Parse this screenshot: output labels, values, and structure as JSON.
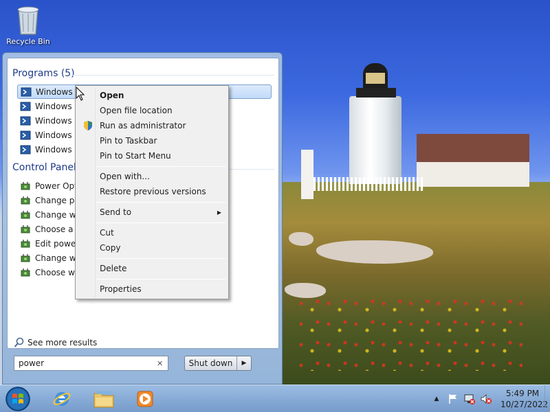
{
  "desktop": {
    "recycle_bin_label": "Recycle Bin"
  },
  "start_menu": {
    "programs_header": "Programs (5)",
    "programs": [
      {
        "label": "Windows PowerShell"
      },
      {
        "label": "Windows PowerShell"
      },
      {
        "label": "Windows PowerShell"
      },
      {
        "label": "Windows PowerShell"
      },
      {
        "label": "Windows PowerShell"
      }
    ],
    "programs_visible": [
      "Windows P",
      "Windows P",
      "Windows P",
      "Windows P",
      "Windows P"
    ],
    "control_panel_header": "Control Panel",
    "control_panel_items": [
      "Power Opti",
      "Change pow",
      "Change wh",
      "Choose a p",
      "Edit power",
      "Change wh",
      "Choose wh"
    ],
    "see_more_label": "See more results",
    "search_value": "power",
    "clear_label": "✕",
    "shutdown_label": "Shut down",
    "shutdown_arrow": "▶"
  },
  "context_menu": {
    "items": {
      "open": "Open",
      "open_file_location": "Open file location",
      "run_as_admin": "Run as administrator",
      "pin_taskbar": "Pin to Taskbar",
      "pin_start": "Pin to Start Menu",
      "open_with": "Open with...",
      "restore_versions": "Restore previous versions",
      "send_to": "Send to",
      "cut": "Cut",
      "copy": "Copy",
      "delete": "Delete",
      "properties": "Properties"
    },
    "submenu_arrow": "▶"
  },
  "taskbar": {
    "pinned": [
      "windows-orb",
      "internet-explorer",
      "file-explorer",
      "media-player"
    ],
    "tray_arrow": "▲",
    "clock_time": "5:49 PM",
    "clock_date": "10/27/2022"
  },
  "colors": {
    "accent_blue": "#1f3b87",
    "selection": "#c1dbfa"
  }
}
